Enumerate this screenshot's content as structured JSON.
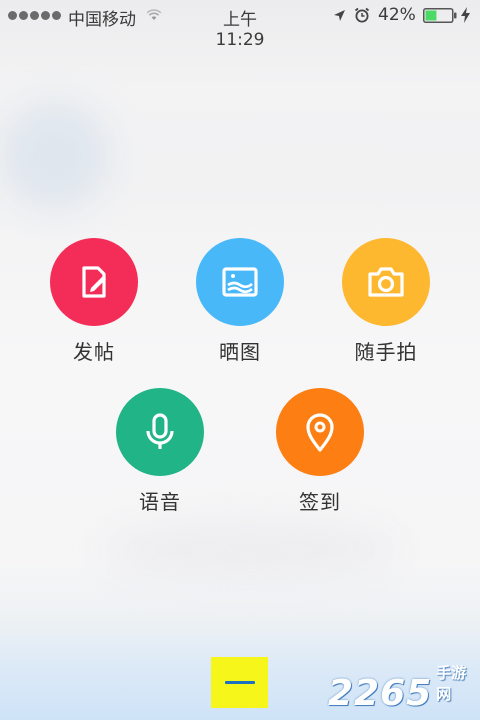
{
  "status_bar": {
    "carrier": "中国移动",
    "time": "上午11:29",
    "battery_percent": "42%",
    "battery_level": 0.42,
    "icons": [
      "signal-dots",
      "wifi-icon",
      "location-arrow-icon",
      "alarm-clock-icon",
      "battery-icon",
      "charging-bolt-icon"
    ]
  },
  "actions": [
    {
      "label": "发帖",
      "icon": "edit-note-icon",
      "color": "#f32d57"
    },
    {
      "label": "晒图",
      "icon": "picture-icon",
      "color": "#48b8f8"
    },
    {
      "label": "随手拍",
      "icon": "camera-icon",
      "color": "#fdb82f"
    },
    {
      "label": "语音",
      "icon": "microphone-icon",
      "color": "#20b486"
    },
    {
      "label": "签到",
      "icon": "location-pin-icon",
      "color": "#fd7e13"
    }
  ],
  "close_button": {
    "icon": "minus-icon",
    "color": "#f6f61a"
  },
  "watermark": {
    "number": "2265",
    "suffix": "手游网"
  }
}
